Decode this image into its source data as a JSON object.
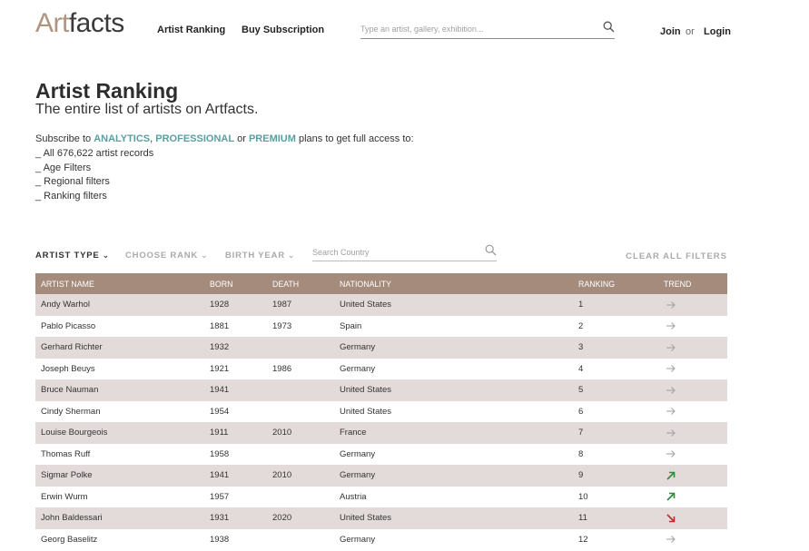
{
  "header": {
    "logo_part1": "Art",
    "logo_part2": "facts",
    "nav": [
      "Artist Ranking",
      "Buy Subscription"
    ],
    "search_placeholder": "Type an artist, gallery, exhibition...",
    "join": "Join",
    "or": "or",
    "login": "Login"
  },
  "page": {
    "title": "Artist Ranking",
    "subtitle": "The entire list of artists on Artfacts.",
    "promo_prefix": "Subscribe to ",
    "plan1": "ANALYTICS",
    "sep1": ", ",
    "plan2": "PROFESSIONAL",
    "sep2": " or ",
    "plan3": "PREMIUM",
    "promo_suffix": " plans to get full access to:",
    "features": [
      "_ All 676,622 artist records",
      "_ Age Filters",
      "_ Regional filters",
      "_ Ranking filters"
    ]
  },
  "filters": {
    "artist_type": "ARTIST TYPE",
    "choose_rank": "CHOOSE RANK",
    "birth_year": "BIRTH YEAR",
    "country_placeholder": "Search Country",
    "clear": "CLEAR ALL FILTERS"
  },
  "table": {
    "headers": [
      "ARTIST NAME",
      "BORN",
      "DEATH",
      "NATIONALITY",
      "RANKING",
      "TREND"
    ],
    "rows": [
      {
        "name": "Andy Warhol",
        "born": "1928",
        "death": "1987",
        "nationality": "United States",
        "ranking": "1",
        "trend": "flat"
      },
      {
        "name": "Pablo Picasso",
        "born": "1881",
        "death": "1973",
        "nationality": "Spain",
        "ranking": "2",
        "trend": "flat"
      },
      {
        "name": "Gerhard Richter",
        "born": "1932",
        "death": "",
        "nationality": "Germany",
        "ranking": "3",
        "trend": "flat"
      },
      {
        "name": "Joseph Beuys",
        "born": "1921",
        "death": "1986",
        "nationality": "Germany",
        "ranking": "4",
        "trend": "flat"
      },
      {
        "name": "Bruce Nauman",
        "born": "1941",
        "death": "",
        "nationality": "United States",
        "ranking": "5",
        "trend": "flat"
      },
      {
        "name": "Cindy Sherman",
        "born": "1954",
        "death": "",
        "nationality": "United States",
        "ranking": "6",
        "trend": "flat"
      },
      {
        "name": "Louise Bourgeois",
        "born": "1911",
        "death": "2010",
        "nationality": "France",
        "ranking": "7",
        "trend": "flat"
      },
      {
        "name": "Thomas Ruff",
        "born": "1958",
        "death": "",
        "nationality": "Germany",
        "ranking": "8",
        "trend": "flat"
      },
      {
        "name": "Sigmar Polke",
        "born": "1941",
        "death": "2010",
        "nationality": "Germany",
        "ranking": "9",
        "trend": "up"
      },
      {
        "name": "Erwin Wurm",
        "born": "1957",
        "death": "",
        "nationality": "Austria",
        "ranking": "10",
        "trend": "up"
      },
      {
        "name": "John Baldessari",
        "born": "1931",
        "death": "2020",
        "nationality": "United States",
        "ranking": "11",
        "trend": "down"
      },
      {
        "name": "Georg Baselitz",
        "born": "1938",
        "death": "",
        "nationality": "Germany",
        "ranking": "12",
        "trend": "flat"
      }
    ]
  },
  "colors": {
    "brand_logo": "#b0947e",
    "plan_link": "#5a9fa0",
    "table_header": "#a48b7c",
    "row_stripe": "#e2dbd9",
    "trend_up": "#2e8b3a",
    "trend_down": "#c0282a",
    "trend_flat": "#a6a6a6"
  }
}
